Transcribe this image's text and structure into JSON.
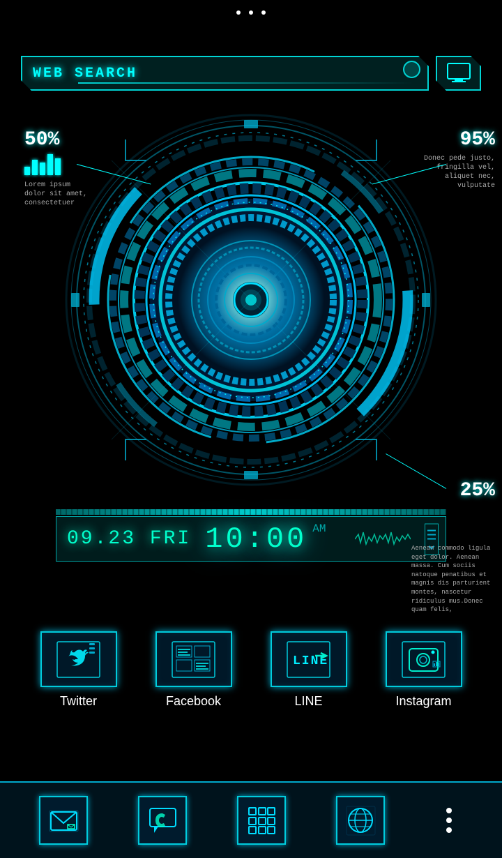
{
  "statusBar": {
    "dots": 3
  },
  "searchBar": {
    "label": "WEB SEARCH",
    "placeholder": "WEB SEARCH"
  },
  "stats": {
    "left": {
      "percent": "50%",
      "bars": [
        15,
        25,
        20,
        35,
        28
      ],
      "description": "Lorem ipsum dolor sit amet, consectetuer"
    },
    "right": {
      "percent": "95%",
      "description": "Donec pede justo, fringilla vel, aliquet nec, vulputate"
    },
    "bottom": {
      "percent": "25%"
    }
  },
  "clock": {
    "date": "09.23 FRI",
    "time": "10:00",
    "ampm": "AM"
  },
  "textPanel": {
    "text": "Aenean commodo ligula eget dolor. Aenean massa. Cum sociis natoque penatibus et magnis dis parturient montes, nascetur ridiculus mus.Donec quam felis,"
  },
  "apps": [
    {
      "id": "twitter",
      "label": "Twitter"
    },
    {
      "id": "facebook",
      "label": "Facebook"
    },
    {
      "id": "line",
      "label": "LINE"
    },
    {
      "id": "instagram",
      "label": "Instagram"
    }
  ],
  "bottomNav": [
    {
      "id": "email",
      "label": "Email"
    },
    {
      "id": "phone",
      "label": "Phone"
    },
    {
      "id": "apps",
      "label": "Apps"
    },
    {
      "id": "browser",
      "label": "Browser"
    },
    {
      "id": "more",
      "label": "More"
    }
  ]
}
